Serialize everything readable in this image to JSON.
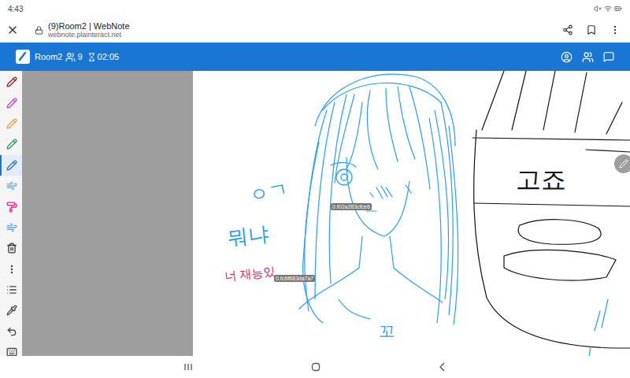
{
  "status_bar": {
    "time": "4:43"
  },
  "browser": {
    "title": "(9)Room2 | WebNote",
    "url": "webnote.plainteract.net"
  },
  "app_bar": {
    "room": "Room2",
    "participants": "9",
    "timer": "02:05"
  },
  "tools": [
    {
      "kind": "pen",
      "color": "#9b1c1c",
      "selected": false
    },
    {
      "kind": "pen",
      "color": "#d63ad6",
      "selected": false
    },
    {
      "kind": "pen",
      "color": "#f29a3e",
      "selected": false
    },
    {
      "kind": "pen",
      "color": "#1f9d55",
      "selected": false
    },
    {
      "kind": "pen",
      "color": "#1e6fd9",
      "selected": true
    },
    {
      "kind": "wind",
      "color": "#6aa8e8",
      "selected": false
    },
    {
      "kind": "roller",
      "color": "#e91e8c",
      "selected": false
    },
    {
      "kind": "wind",
      "color": "#6aa8e8",
      "selected": false
    },
    {
      "kind": "trash",
      "color": "#333333",
      "selected": false
    },
    {
      "kind": "more",
      "color": "#444444",
      "selected": false
    },
    {
      "kind": "list",
      "color": "#444444",
      "selected": false
    },
    {
      "kind": "eyedropper",
      "color": "#444444",
      "selected": false
    },
    {
      "kind": "undo",
      "color": "#444444",
      "selected": false
    },
    {
      "kind": "keyboard",
      "color": "#444444",
      "selected": false
    }
  ],
  "canvas": {
    "texts": [
      {
        "text": "ㅇㄱ",
        "color": "#2a9df4"
      },
      {
        "text": "뭐냐",
        "color": "#2a9df4"
      },
      {
        "text": "너 재능있",
        "color": "#d81b60"
      },
      {
        "text": "고죠",
        "color": "#111111"
      },
      {
        "text": "꼬",
        "color": "#2a9df4"
      }
    ],
    "cursors": [
      {
        "label": "0.f02a283cfce6"
      },
      {
        "label": "0.fc6f683da7a7"
      }
    ]
  }
}
